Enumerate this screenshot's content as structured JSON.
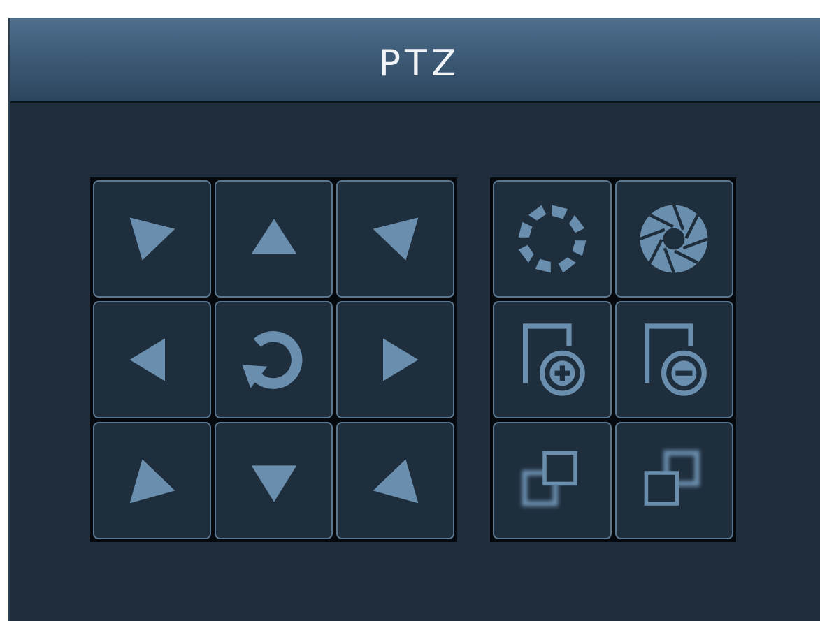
{
  "window": {
    "title": "PTZ"
  },
  "colors": {
    "panel_bg": "#1f2d3c",
    "title_bar": "#3d5b77",
    "icon": "#6a8eae",
    "button_border": "#5b7790",
    "grid_bg": "#05090d"
  },
  "direction_pad": {
    "buttons": [
      {
        "icon": "arrow-up-left-icon"
      },
      {
        "icon": "arrow-up-icon"
      },
      {
        "icon": "arrow-up-right-icon"
      },
      {
        "icon": "arrow-left-icon"
      },
      {
        "icon": "auto-rotate-icon"
      },
      {
        "icon": "arrow-right-icon"
      },
      {
        "icon": "arrow-down-left-icon"
      },
      {
        "icon": "arrow-down-icon"
      },
      {
        "icon": "arrow-down-right-icon"
      }
    ]
  },
  "lens_controls": {
    "buttons": [
      {
        "icon": "iris-open-icon"
      },
      {
        "icon": "iris-close-icon"
      },
      {
        "icon": "zoom-in-icon"
      },
      {
        "icon": "zoom-out-icon"
      },
      {
        "icon": "focus-near-icon"
      },
      {
        "icon": "focus-far-icon"
      }
    ]
  }
}
